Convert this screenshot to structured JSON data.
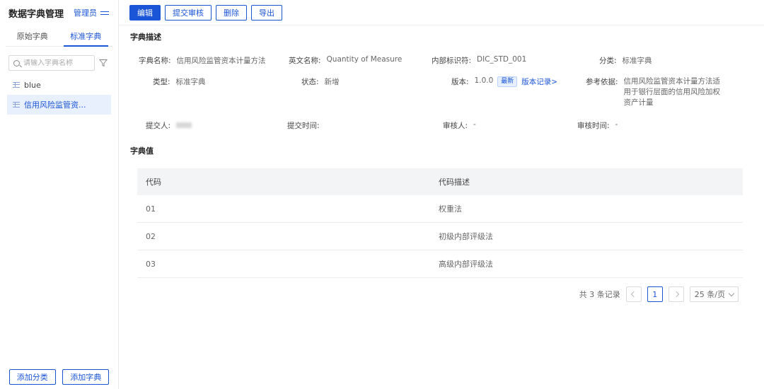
{
  "sidebar": {
    "title": "数据字典管理",
    "user": "管理员",
    "tabs": [
      {
        "label": "原始字典"
      },
      {
        "label": "标准字典"
      }
    ],
    "search_placeholder": "请输入字典名称",
    "items": [
      {
        "label": "blue"
      },
      {
        "label": "信用风险监管资..."
      }
    ],
    "footer": {
      "add_category": "添加分类",
      "add_dictionary": "添加字典"
    }
  },
  "toolbar": {
    "edit": "编辑",
    "submit_review": "提交审核",
    "delete": "删除",
    "export": "导出"
  },
  "description": {
    "section_title": "字典描述",
    "dict_name_label": "字典名称:",
    "dict_name": "信用风险监管资本计量方法",
    "en_name_label": "英文名称:",
    "en_name": "Quantity of Measure",
    "internal_id_label": "内部标识符:",
    "internal_id": "DIC_STD_001",
    "category_label": "分类:",
    "category": "标准字典",
    "type_label": "类型:",
    "type": "标准字典",
    "status_label": "状态:",
    "status": "新增",
    "version_label": "版本:",
    "version": "1.0.0",
    "version_badge": "最新",
    "version_link": "版本记录>",
    "reference_label": "参考依据:",
    "reference": "信用风险监管资本计量方法适用于银行层面的信用风险加权资产计量",
    "submitter_label": "提交人:",
    "submit_time_label": "提交时间:",
    "reviewer_label": "审核人:",
    "reviewer": "-",
    "review_time_label": "审核时间:",
    "review_time": "-"
  },
  "values": {
    "section_title": "字典值",
    "columns": [
      "代码",
      "代码描述"
    ],
    "rows": [
      {
        "code": "01",
        "desc": "权重法"
      },
      {
        "code": "02",
        "desc": "初级内部评级法"
      },
      {
        "code": "03",
        "desc": "高级内部评级法"
      }
    ]
  },
  "pagination": {
    "total": "共 3 条记录",
    "current": "1",
    "page_size": "25 条/页"
  },
  "colors": {
    "accent": "#1a55d8"
  }
}
